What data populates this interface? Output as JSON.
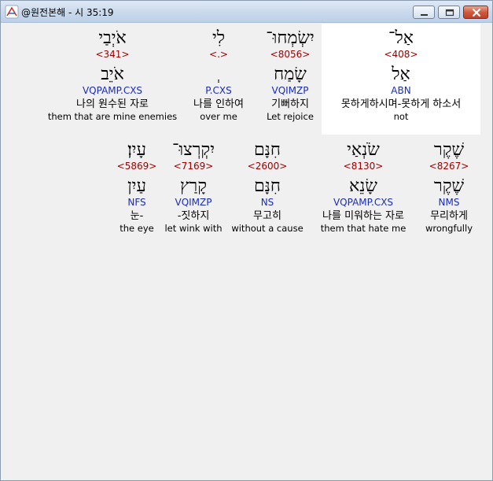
{
  "window": {
    "title": "@원전본해 - 시 35:19",
    "controls": {
      "minimize": "minimize",
      "maximize": "maximize",
      "close": "close"
    }
  },
  "rows": [
    {
      "words": [
        {
          "heb": "אַל־",
          "strong": "<408>",
          "root": "אַל",
          "morph": "ABN",
          "kor": "못하게하시며-못하게 하소서",
          "eng": "not",
          "highlight": true
        },
        {
          "heb": "יִשְׂמְחוּ־",
          "strong": "<8056>",
          "root": "שָׂמַח",
          "morph": "VQIMZP",
          "kor": "기뻐하지",
          "eng": "Let rejoice"
        },
        {
          "heb": "לִי",
          "strong": "<.>",
          "root": "ְ",
          "morph": "P.CXS",
          "kor": "나를 인하여",
          "eng": "over me"
        },
        {
          "heb": "אֹיְבַי",
          "strong": "<341>",
          "root": "אֹיֵב",
          "morph": "VQPAMP.CXS",
          "kor": "나의 원수된 자로",
          "eng": "them that are mine enemies"
        }
      ]
    },
    {
      "words": [
        {
          "heb": "שֶׁקֶר",
          "strong": "<8267>",
          "root": "שֶׁקֶר",
          "morph": "NMS",
          "kor": "무리하게",
          "eng": "wrongfully"
        },
        {
          "heb": "שֹׂנְאַי",
          "strong": "<8130>",
          "root": "שָׂנֵא",
          "morph": "VQPAMP.CXS",
          "kor": "나를 미워하는 자로",
          "eng": "them that hate me"
        },
        {
          "heb": "חִנָּם",
          "strong": "<2600>",
          "root": "חִנָּם",
          "morph": "NS",
          "kor": "무고히",
          "eng": "without a cause"
        },
        {
          "heb": "יִקְרְצוּ־",
          "strong": "<7169>",
          "root": "קָרַץ",
          "morph": "VQIMZP",
          "kor": "-짓하지",
          "eng": "let wink with"
        },
        {
          "heb": "עָיִן׃",
          "strong": "<5869>",
          "root": "עַיִן",
          "morph": "NFS",
          "kor": "눈-",
          "eng": "the eye"
        }
      ]
    }
  ]
}
